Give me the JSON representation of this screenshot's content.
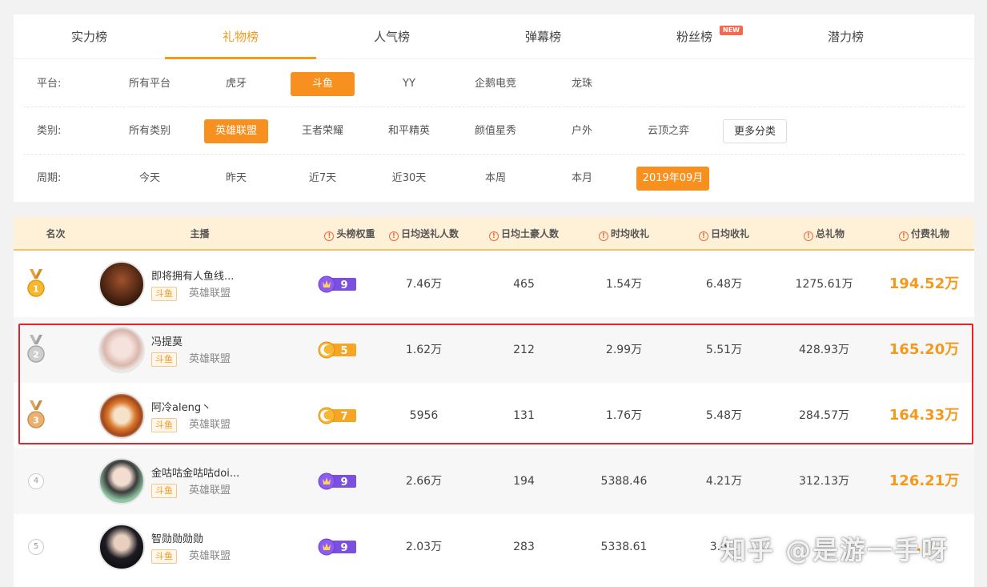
{
  "tabs": [
    {
      "label": "实力榜"
    },
    {
      "label": "礼物榜"
    },
    {
      "label": "人气榜"
    },
    {
      "label": "弹幕榜"
    },
    {
      "label": "粉丝榜",
      "badge": "NEW"
    },
    {
      "label": "潜力榜"
    }
  ],
  "active_tab": "礼物榜",
  "filters": {
    "platform": {
      "label": "平台:",
      "options": [
        "所有平台",
        "虎牙",
        "斗鱼",
        "YY",
        "企鹅电竞",
        "龙珠"
      ],
      "selected": "斗鱼"
    },
    "category": {
      "label": "类别:",
      "options": [
        "所有类别",
        "英雄联盟",
        "王者荣耀",
        "和平精英",
        "颜值星秀",
        "户外",
        "云顶之弈"
      ],
      "selected": "英雄联盟",
      "more_button": "更多分类"
    },
    "period": {
      "label": "周期:",
      "options": [
        "今天",
        "昨天",
        "近7天",
        "近30天",
        "本周",
        "本月",
        "2019年09月"
      ],
      "selected": "2019年09月"
    }
  },
  "table": {
    "headers": [
      "名次",
      "主播",
      "头榜权重",
      "日均送礼人数",
      "日均土豪人数",
      "时均收礼",
      "日均收礼",
      "总礼物",
      "付费礼物"
    ],
    "rows": [
      {
        "rank": "1",
        "name": "即将拥有人鱼线...",
        "platform": "斗鱼",
        "category": "英雄联盟",
        "weight": "9",
        "weight_type": "purple",
        "daily_givers": "7.46万",
        "daily_whales": "465",
        "hourly_gifts": "1.54万",
        "daily_gifts": "6.48万",
        "total_gifts": "1275.61万",
        "paid_gifts": "194.52万"
      },
      {
        "rank": "2",
        "name": "冯提莫",
        "platform": "斗鱼",
        "category": "英雄联盟",
        "weight": "5",
        "weight_type": "orange",
        "daily_givers": "1.62万",
        "daily_whales": "212",
        "hourly_gifts": "2.99万",
        "daily_gifts": "5.51万",
        "total_gifts": "428.93万",
        "paid_gifts": "165.20万"
      },
      {
        "rank": "3",
        "name": "阿冷aleng丶",
        "platform": "斗鱼",
        "category": "英雄联盟",
        "weight": "7",
        "weight_type": "orange",
        "daily_givers": "5956",
        "daily_whales": "131",
        "hourly_gifts": "1.76万",
        "daily_gifts": "5.48万",
        "total_gifts": "284.57万",
        "paid_gifts": "164.33万"
      },
      {
        "rank": "4",
        "name": "金咕咕金咕咕doi...",
        "platform": "斗鱼",
        "category": "英雄联盟",
        "weight": "9",
        "weight_type": "purple",
        "daily_givers": "2.66万",
        "daily_whales": "194",
        "hourly_gifts": "5388.46",
        "daily_gifts": "4.21万",
        "total_gifts": "312.13万",
        "paid_gifts": "126.21万"
      },
      {
        "rank": "5",
        "name": "智勋勋勋勋",
        "platform": "斗鱼",
        "category": "英雄联盟",
        "weight": "9",
        "weight_type": "purple",
        "daily_givers": "2.03万",
        "daily_whales": "283",
        "hourly_gifts": "5338.61",
        "daily_gifts": "3.6...",
        "total_gifts": "...",
        "paid_gifts": "..."
      }
    ]
  },
  "watermark": "知乎 @是游一手呀",
  "colors": {
    "accent": "#f39a1e",
    "header_bg": "#fff1d8",
    "highlight": "#e0262c",
    "purple_badge": "#7b4fe0",
    "orange_badge": "#f6a623"
  }
}
